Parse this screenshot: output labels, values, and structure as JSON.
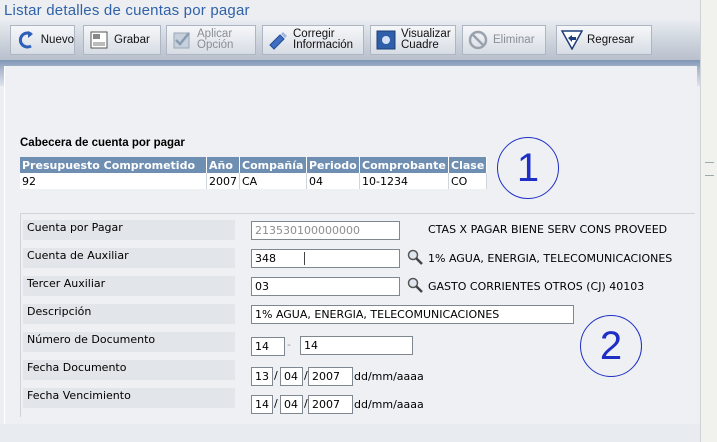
{
  "page_title": "Listar detalles de cuentas por pagar",
  "toolbar": {
    "buttons": [
      {
        "label": "Nuevo",
        "icon": "new-arrow-icon",
        "enabled": true
      },
      {
        "label": "Grabar",
        "icon": "save-icon",
        "enabled": true
      },
      {
        "label": "Aplicar Opción",
        "line1": "Aplicar",
        "line2": "Opción",
        "icon": "check-icon",
        "enabled": false
      },
      {
        "label": "Corregir Información",
        "line1": "Corregir",
        "line2": "Información",
        "icon": "edit-pen-icon",
        "enabled": true
      },
      {
        "label": "Visualizar Cuadre",
        "line1": "Visualizar",
        "line2": "Cuadre",
        "icon": "view-icon",
        "enabled": true
      },
      {
        "label": "Eliminar",
        "icon": "delete-icon",
        "enabled": false
      },
      {
        "label": "Regresar",
        "icon": "back-arrow-icon",
        "enabled": true
      }
    ]
  },
  "header_section": {
    "title": "Cabecera de cuenta por pagar",
    "columns": [
      "Presupuesto Comprometido",
      "Año",
      "Compañía",
      "Periodo",
      "Comprobante",
      "Clase"
    ],
    "row": [
      "92",
      "2007",
      "CA",
      "04",
      "10-1234",
      "CO"
    ]
  },
  "annotations": {
    "one": "1",
    "two": "2"
  },
  "form": {
    "cuenta_por_pagar": {
      "label": "Cuenta por Pagar",
      "value": "213530100000000",
      "description": "CTAS X PAGAR BIENE SERV CONS PROVEED"
    },
    "cuenta_auxiliar": {
      "label": "Cuenta de Auxiliar",
      "value": "348",
      "description": "1% AGUA, ENERGIA, TELECOMUNICACIONES"
    },
    "tercer_auxiliar": {
      "label": "Tercer Auxiliar",
      "value": "03",
      "description": "GASTO CORRIENTES OTROS (CJ) 40103"
    },
    "descripcion": {
      "label": "Descripción",
      "value": "1% AGUA, ENERGIA, TELECOMUNICACIONES"
    },
    "numero_documento": {
      "label": "Número de Documento",
      "value1": "14",
      "separator": "-",
      "value2": "14"
    },
    "fecha_documento": {
      "label": "Fecha Documento",
      "day": "13",
      "month": "04",
      "year": "2007",
      "format": "dd/mm/aaaa"
    },
    "fecha_vencimiento": {
      "label": "Fecha Vencimiento",
      "day": "14",
      "month": "04",
      "year": "2007",
      "format": "dd/mm/aaaa"
    }
  },
  "colors": {
    "title": "#2f62a8",
    "table_header": "#6f8fb2",
    "annotation": "#1f2fc6"
  }
}
